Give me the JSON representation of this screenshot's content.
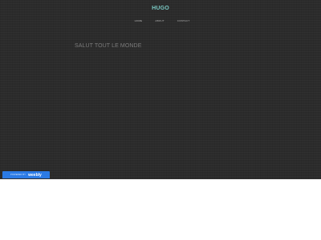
{
  "site": {
    "title": "HUGO",
    "title_color": "#79c7c2",
    "background_color": "#2b2b2b"
  },
  "nav": {
    "items": [
      {
        "label": "HOME"
      },
      {
        "label": "ABOUT"
      },
      {
        "label": "CONTACT"
      }
    ]
  },
  "main": {
    "heading": "SALUT TOUT LE MONDE"
  },
  "footer_badge": {
    "prefix": "POWERED BY",
    "brand": "weebly",
    "color": "#2c7be5"
  }
}
